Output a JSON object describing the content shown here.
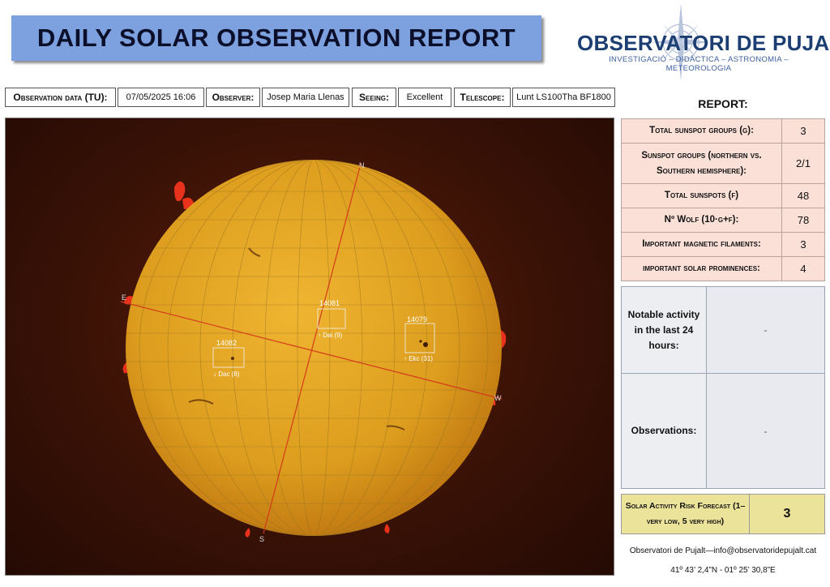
{
  "title": "DAILY SOLAR OBSERVATION REPORT",
  "logo": {
    "name": "OBSERVATORI DE PUJALT",
    "subtitle": "INVESTIGACIÓ – DIDÀCTICA – ASTRONOMIA – METEOROLOGIA"
  },
  "info": {
    "observation_label": "Observation data (TU):",
    "observation_value": "07/05/2025 16:06",
    "observer_label": "Observer:",
    "observer_value": "Josep Maria Llenas",
    "seeing_label": "Seeing:",
    "seeing_value": "Excellent",
    "telescope_label": "Telescope:",
    "telescope_value": "Lunt LS100Tha BF1800"
  },
  "sun_image": {
    "directions": {
      "n": "N",
      "s": "S",
      "e": "E",
      "w": "W"
    },
    "regions": [
      {
        "number": "14082",
        "class": "↓ Dac (8)"
      },
      {
        "number": "14081",
        "class": "↑ Dai (9)"
      },
      {
        "number": "14079",
        "class": "↑ Ekc (31)"
      }
    ]
  },
  "report": {
    "heading": "REPORT:",
    "rows": [
      {
        "label": "Total sunspot groups (g):",
        "value": "3"
      },
      {
        "label": "Sunspot groups (northern vs. Southern hemisphere):",
        "value": "2/1"
      },
      {
        "label": "Total sunspots (f)",
        "value": "48"
      },
      {
        "label": "Nº Wolf (10·g+f):",
        "value": "78"
      },
      {
        "label": "Important magnetic filaments:",
        "value": "3"
      },
      {
        "label": "important solar prominences:",
        "value": "4"
      }
    ],
    "notable_label": "Notable activity in the last 24 hours:",
    "notable_value": "-",
    "observations_label": "Observations:",
    "observations_value": "-",
    "risk_label": "Solar Activity Risk Forecast (1– very low, 5 very high)",
    "risk_value": "3"
  },
  "footer": {
    "contact": "Observatori de Pujalt—info@observatoridepujalt.cat",
    "coords": "41º 43’ 2,4”N - 01º 25’ 30,8”E"
  },
  "colors": {
    "title_bg": "#7da0de",
    "stats_bg": "#fbe0d7",
    "notes_bg": "#e8eaef",
    "risk_bg": "#ece39a",
    "sun_disk": "#e0a020",
    "prominence": "#e8321c"
  }
}
